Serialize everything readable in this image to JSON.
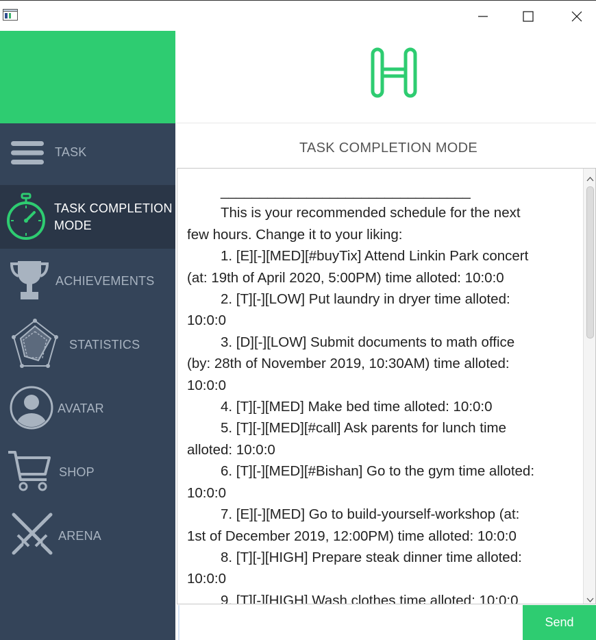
{
  "window": {
    "min_icon": "minimize-icon",
    "max_icon": "maximize-icon",
    "close_icon": "close-icon"
  },
  "colors": {
    "accent": "#2ecc71",
    "sidebar": "#344459",
    "sidebar_active": "#2a3647",
    "nav_text": "#a8b3c0"
  },
  "sidebar": {
    "items": [
      {
        "label": "TASK",
        "icon": "hamburger-menu-icon"
      },
      {
        "label": "TASK COMPLETION MODE",
        "line1": "TASK COMPLETION",
        "line2": "MODE",
        "icon": "stopwatch-icon",
        "active": true
      },
      {
        "label": "ACHIEVEMENTS",
        "icon": "trophy-icon"
      },
      {
        "label": "STATISTICS",
        "icon": "radar-chart-icon"
      },
      {
        "label": "AVATAR",
        "icon": "user-avatar-icon"
      },
      {
        "label": "SHOP",
        "icon": "shopping-cart-icon"
      },
      {
        "label": "ARENA",
        "icon": "crossed-swords-icon"
      }
    ]
  },
  "main": {
    "logo_icon": "h-logo-icon",
    "mode_title": "TASK COMPLETION MODE",
    "output_lines": [
      {
        "indent": true,
        "text": "________________________________"
      },
      {
        "indent": true,
        "text": "This is your recommended schedule for the next"
      },
      {
        "indent": false,
        "text": "few hours. Change it to your liking:"
      },
      {
        "indent": true,
        "text": "1. [E][-][MED][#buyTix] Attend Linkin Park concert"
      },
      {
        "indent": false,
        "text": "(at: 19th of April 2020, 5:00PM) time alloted: 10:0:0"
      },
      {
        "indent": true,
        "text": "2. [T][-][LOW] Put laundry in dryer time alloted:"
      },
      {
        "indent": false,
        "text": "10:0:0"
      },
      {
        "indent": true,
        "text": "3. [D][-][LOW] Submit documents to math office"
      },
      {
        "indent": false,
        "text": "(by: 28th of November 2019, 10:30AM) time alloted:"
      },
      {
        "indent": false,
        "text": "10:0:0"
      },
      {
        "indent": true,
        "text": "4. [T][-][MED] Make bed time alloted: 10:0:0"
      },
      {
        "indent": true,
        "text": "5. [T][-][MED][#call] Ask parents for lunch time"
      },
      {
        "indent": false,
        "text": "alloted: 10:0:0"
      },
      {
        "indent": true,
        "text": "6. [T][-][MED][#Bishan] Go to the gym time alloted:"
      },
      {
        "indent": false,
        "text": "10:0:0"
      },
      {
        "indent": true,
        "text": "7. [E][-][MED] Go to build-yourself-workshop (at:"
      },
      {
        "indent": false,
        "text": "1st of December 2019, 12:00PM) time alloted: 10:0:0"
      },
      {
        "indent": true,
        "text": "8. [T][-][HIGH] Prepare steak dinner time alloted:"
      },
      {
        "indent": false,
        "text": "10:0:0"
      },
      {
        "indent": true,
        "text": "9. [T][-][HIGH] Wash clothes time alloted: 10:0:0"
      }
    ],
    "input_value": "",
    "send_label": "Send"
  }
}
